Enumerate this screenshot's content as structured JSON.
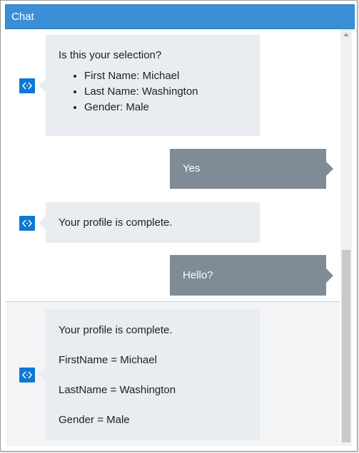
{
  "window": {
    "title": "Chat"
  },
  "messages": [
    {
      "role": "bot",
      "intro": "Is this your selection?",
      "items": [
        "First Name: Michael",
        "Last Name: Washington",
        "Gender: Male"
      ]
    },
    {
      "role": "user",
      "text": "Yes"
    },
    {
      "role": "bot",
      "text": "Your profile is complete."
    },
    {
      "role": "user",
      "text": "Hello?"
    },
    {
      "role": "bot",
      "lines": [
        "Your profile is complete.",
        "FirstName = Michael",
        "LastName = Washington",
        "Gender = Male"
      ]
    }
  ],
  "icons": {
    "bot_avatar": "code-brackets-icon"
  },
  "colors": {
    "titlebar": "#3a8fd6",
    "user_bubble": "#7f8b95",
    "bot_bubble": "#e9ecf0",
    "bot_icon": "#0f78d4"
  }
}
